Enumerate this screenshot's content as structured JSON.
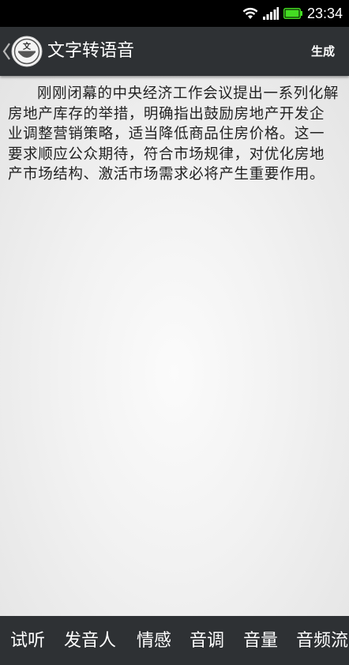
{
  "status_bar": {
    "time": "23:34",
    "icons": [
      "wifi-icon",
      "signal-icon",
      "battery-icon"
    ],
    "battery_color": "#44dd22"
  },
  "action_bar": {
    "title": "文字转语音",
    "action_label": "生成",
    "icon_glyph": "文",
    "background": "#2e3134"
  },
  "content": {
    "text": "刚刚闭幕的中央经济工作会议提出一系列化解房地产库存的举措，明确指出鼓励房地产开发企业调整营销策略，适当降低商品住房价格。这一要求顺应公众期待，符合市场规律，对优化房地产市场结构、激活市场需求必将产生重要作用。"
  },
  "tabs": [
    {
      "label": "试听"
    },
    {
      "label": "发音人"
    },
    {
      "label": "情感"
    },
    {
      "label": "音调"
    },
    {
      "label": "音量"
    },
    {
      "label": "音频流"
    }
  ]
}
